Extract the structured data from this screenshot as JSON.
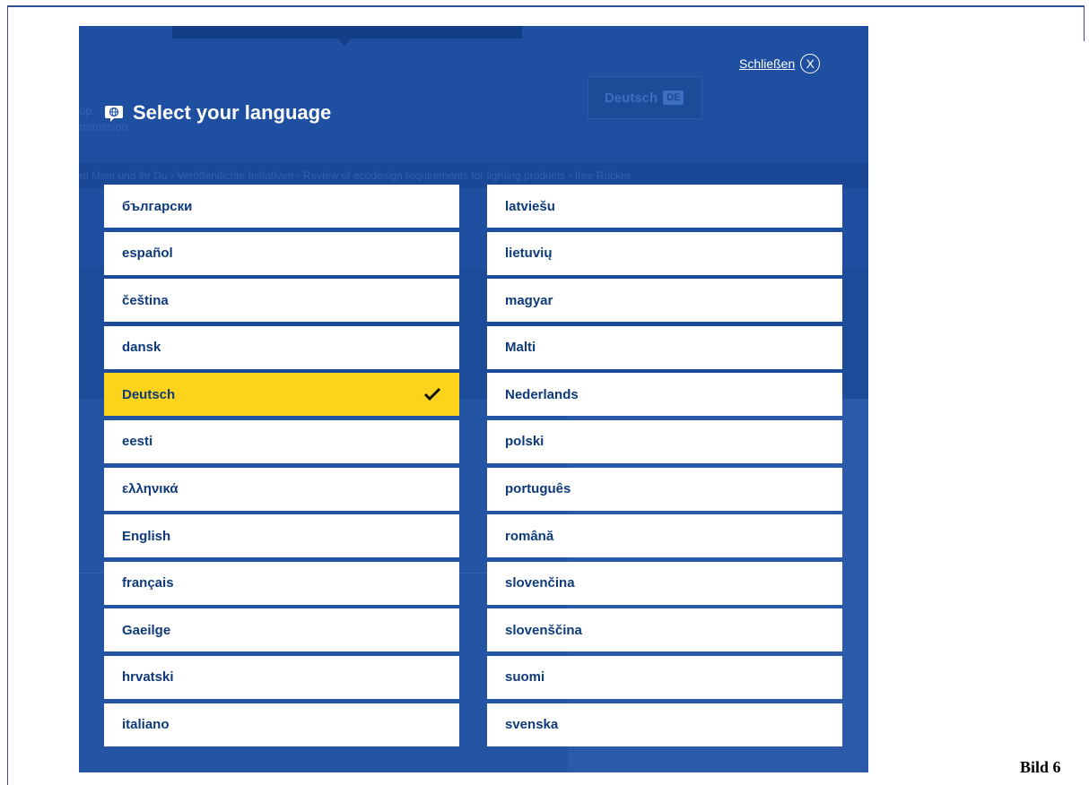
{
  "overlay": {
    "close_label": "Schließen",
    "close_glyph": "X",
    "title": "Select your language",
    "selected": "Deutsch"
  },
  "languages_left": [
    {
      "label": "български"
    },
    {
      "label": "español"
    },
    {
      "label": "čeština"
    },
    {
      "label": "dansk"
    },
    {
      "label": "Deutsch",
      "selected": true
    },
    {
      "label": "eesti"
    },
    {
      "label": "ελληνικά"
    },
    {
      "label": "English"
    },
    {
      "label": "français"
    },
    {
      "label": "Gaeilge"
    },
    {
      "label": "hrvatski"
    },
    {
      "label": "italiano"
    }
  ],
  "languages_right": [
    {
      "label": "latviešu"
    },
    {
      "label": "lietuvių"
    },
    {
      "label": "magyar"
    },
    {
      "label": "Malti"
    },
    {
      "label": "Nederlands"
    },
    {
      "label": "polski"
    },
    {
      "label": "português"
    },
    {
      "label": "română"
    },
    {
      "label": "slovenčina"
    },
    {
      "label": "slovenščina"
    },
    {
      "label": "suomi"
    },
    {
      "label": "svenska"
    }
  ],
  "background_page": {
    "language_button": "Deutsch",
    "language_code": "DE",
    "breadcrumb": "ro Mein und ihr Du › Veröffentlichte Initiativen › Review of ecodesign requirements for lighting products › Ihre Rückm",
    "header_fragment": "op\nmmission"
  },
  "caption": "Bild 6",
  "colors": {
    "overlay_bg": "#1e4fa0",
    "item_bg": "#ffffff",
    "item_text": "#0e3a7a",
    "selected_bg": "#fdd41b"
  }
}
